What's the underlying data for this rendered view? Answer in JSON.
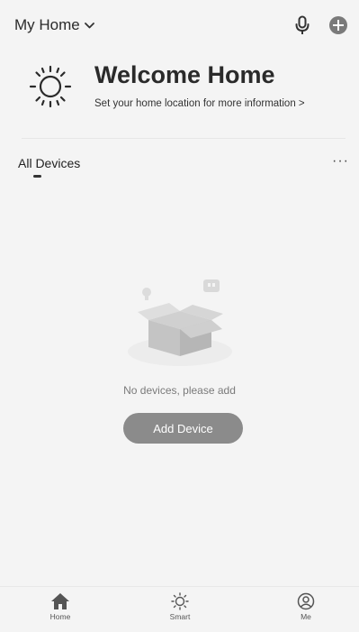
{
  "header": {
    "home_label": "My Home",
    "icons": [
      "chevron-down-icon",
      "microphone-icon",
      "plus-icon"
    ]
  },
  "welcome": {
    "title": "Welcome Home",
    "subtitle": "Set your home location for more information  >",
    "icon": "sun-icon"
  },
  "tabs": {
    "active": "All Devices",
    "more": "···"
  },
  "empty_state": {
    "message": "No devices, please add",
    "button_label": "Add Device"
  },
  "bottom_nav": {
    "items": [
      {
        "label": "Home",
        "icon": "home-icon",
        "active": true
      },
      {
        "label": "Smart",
        "icon": "sun-icon",
        "active": false
      },
      {
        "label": "Me",
        "icon": "user-icon",
        "active": false
      }
    ]
  },
  "colors": {
    "background": "#f4f4f4",
    "button": "#8b8b8b",
    "text": "#222222"
  }
}
